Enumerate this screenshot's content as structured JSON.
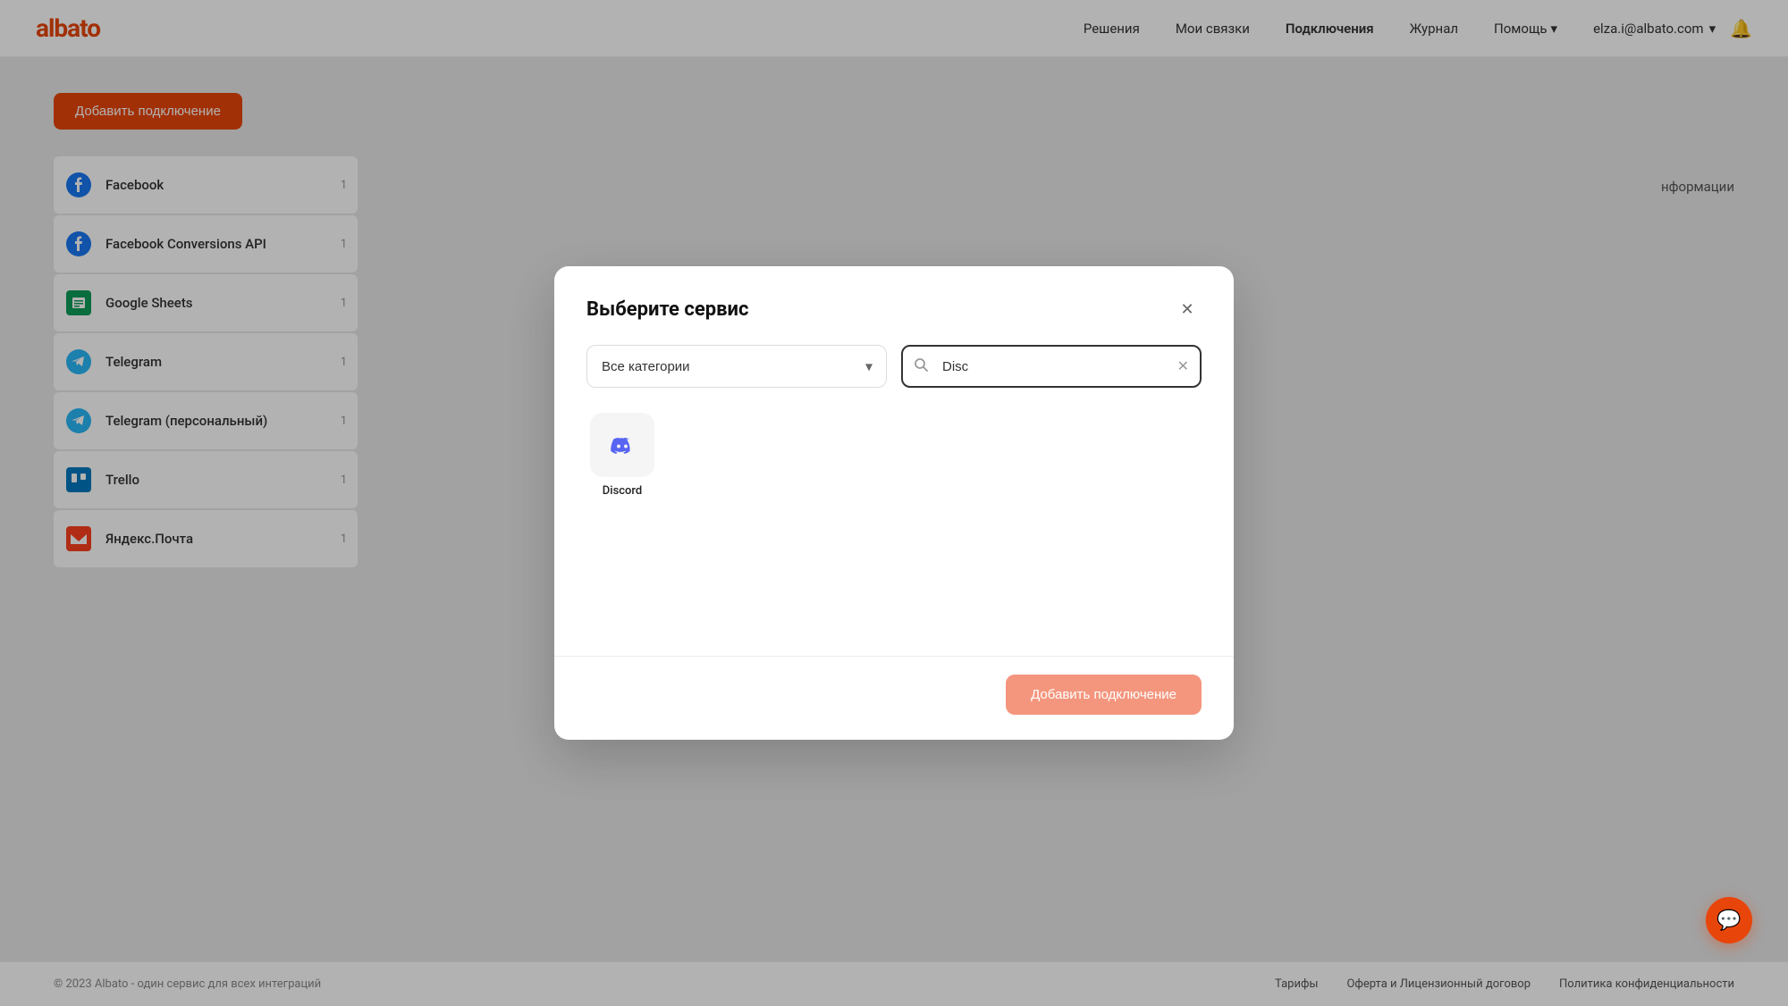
{
  "header": {
    "logo": "albato",
    "nav": [
      {
        "label": "Решения",
        "active": false
      },
      {
        "label": "Мои связки",
        "active": false
      },
      {
        "label": "Подключения",
        "active": true
      },
      {
        "label": "Журнал",
        "active": false
      },
      {
        "label": "Помощь",
        "active": false,
        "hasArrow": true
      }
    ],
    "user_email": "elza.i@albato.com",
    "bell_icon": "🔔"
  },
  "page": {
    "add_connection_btn": "Добавить подключение",
    "connections": [
      {
        "name": "Facebook",
        "icon": "fb",
        "count": "1"
      },
      {
        "name": "Facebook Conversions API",
        "icon": "fb2",
        "count": "1"
      },
      {
        "name": "Google Sheets",
        "icon": "gs",
        "count": "1"
      },
      {
        "name": "Telegram",
        "icon": "tg",
        "count": "1"
      },
      {
        "name": "Telegram (персональный)",
        "icon": "tgp",
        "count": "1"
      },
      {
        "name": "Trello",
        "icon": "trello",
        "count": "1"
      },
      {
        "name": "Яндекс.Почта",
        "icon": "yp",
        "count": "1"
      }
    ]
  },
  "modal": {
    "title": "Выберите сервис",
    "category_label": "Все категории",
    "search_placeholder": "",
    "search_value": "Disc",
    "services": [
      {
        "name": "Discord",
        "icon": "discord"
      }
    ],
    "add_btn": "Добавить подключение"
  },
  "footer": {
    "copy": "© 2023 Albato - один сервис для всех интеграций",
    "links": [
      "Тарифы",
      "Оферта и Лицензионный договор",
      "Политика конфиденциальности"
    ]
  }
}
